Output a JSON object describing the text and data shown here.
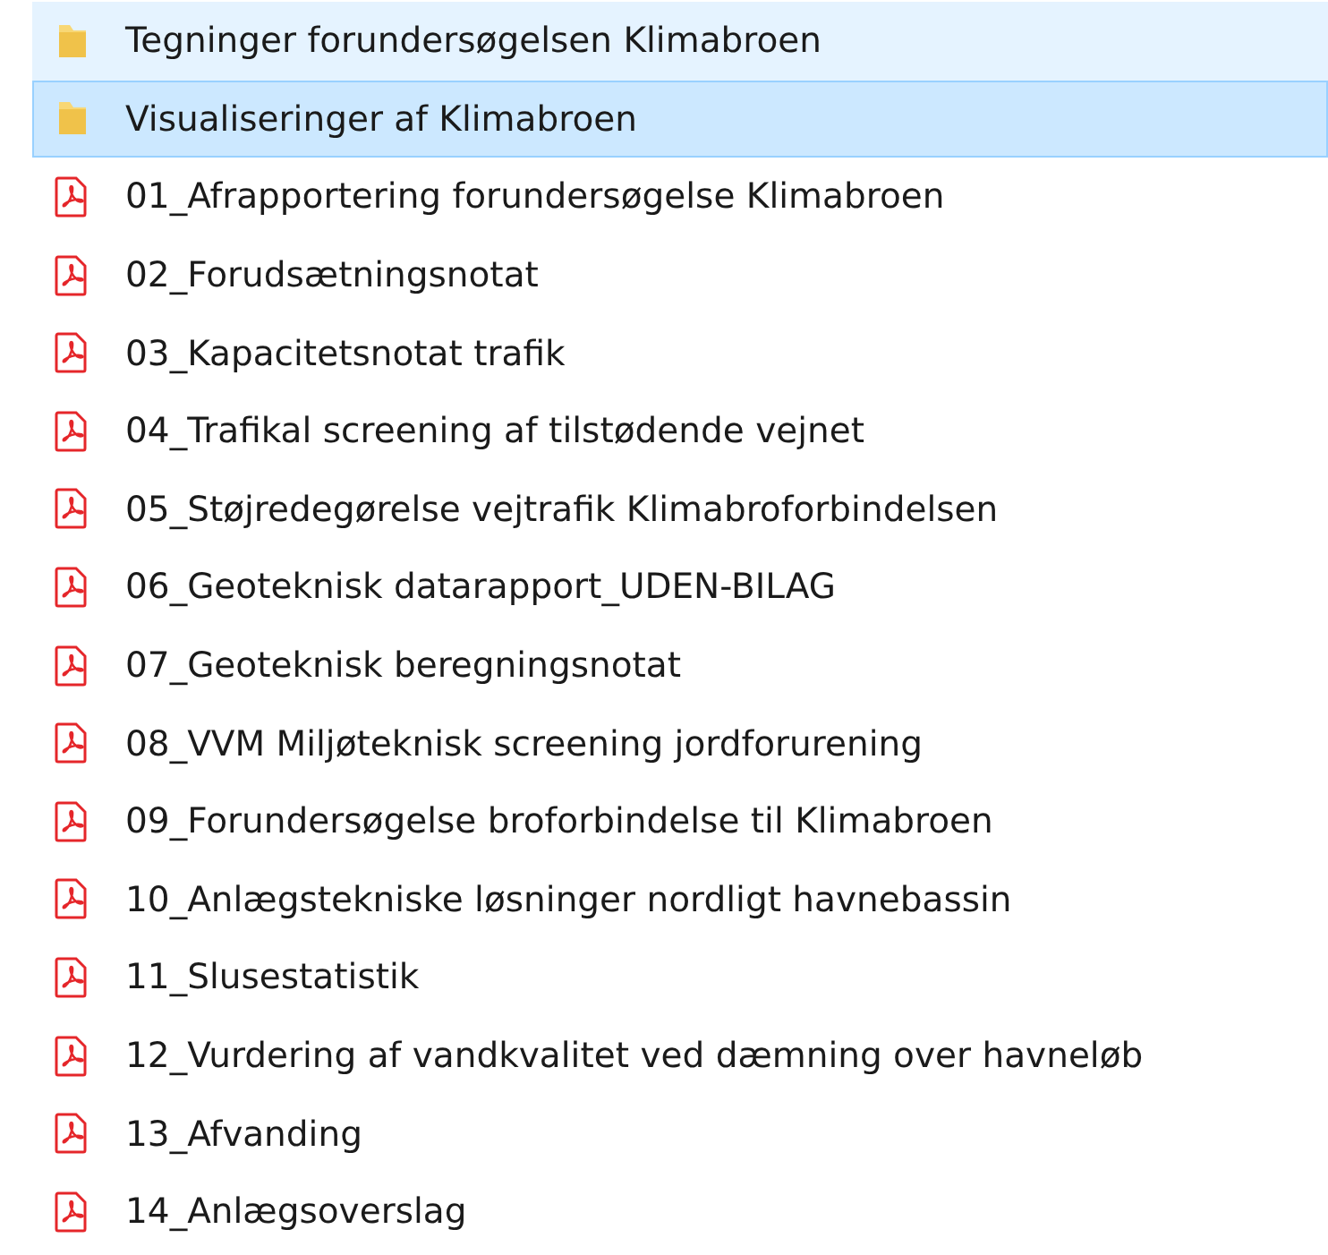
{
  "files": [
    {
      "kind": "folder",
      "name": "Tegninger forundersøgelsen Klimabroen",
      "hovered": true,
      "selected": false
    },
    {
      "kind": "folder",
      "name": "Visualiseringer af Klimabroen",
      "hovered": false,
      "selected": true
    },
    {
      "kind": "pdf",
      "name": "01_Afrapportering forundersøgelse Klimabroen",
      "hovered": false,
      "selected": false
    },
    {
      "kind": "pdf",
      "name": "02_Forudsætningsnotat",
      "hovered": false,
      "selected": false
    },
    {
      "kind": "pdf",
      "name": "03_Kapacitetsnotat trafik",
      "hovered": false,
      "selected": false
    },
    {
      "kind": "pdf",
      "name": "04_Trafikal screening af tilstødende vejnet",
      "hovered": false,
      "selected": false
    },
    {
      "kind": "pdf",
      "name": "05_Støjredegørelse vejtrafik Klimabroforbindelsen",
      "hovered": false,
      "selected": false
    },
    {
      "kind": "pdf",
      "name": "06_Geoteknisk datarapport_UDEN-BILAG",
      "hovered": false,
      "selected": false
    },
    {
      "kind": "pdf",
      "name": "07_Geoteknisk beregningsnotat",
      "hovered": false,
      "selected": false
    },
    {
      "kind": "pdf",
      "name": "08_VVM Miljøteknisk screening jordforurening",
      "hovered": false,
      "selected": false
    },
    {
      "kind": "pdf",
      "name": "09_Forundersøgelse broforbindelse til Klimabroen",
      "hovered": false,
      "selected": false
    },
    {
      "kind": "pdf",
      "name": "10_Anlægstekniske løsninger nordligt havnebassin",
      "hovered": false,
      "selected": false
    },
    {
      "kind": "pdf",
      "name": "11_Slusestatistik",
      "hovered": false,
      "selected": false
    },
    {
      "kind": "pdf",
      "name": "12_Vurdering af vandkvalitet ved dæmning over havneløb",
      "hovered": false,
      "selected": false
    },
    {
      "kind": "pdf",
      "name": "13_Afvanding",
      "hovered": false,
      "selected": false
    },
    {
      "kind": "pdf",
      "name": "14_Anlægsoverslag",
      "hovered": false,
      "selected": false
    }
  ]
}
